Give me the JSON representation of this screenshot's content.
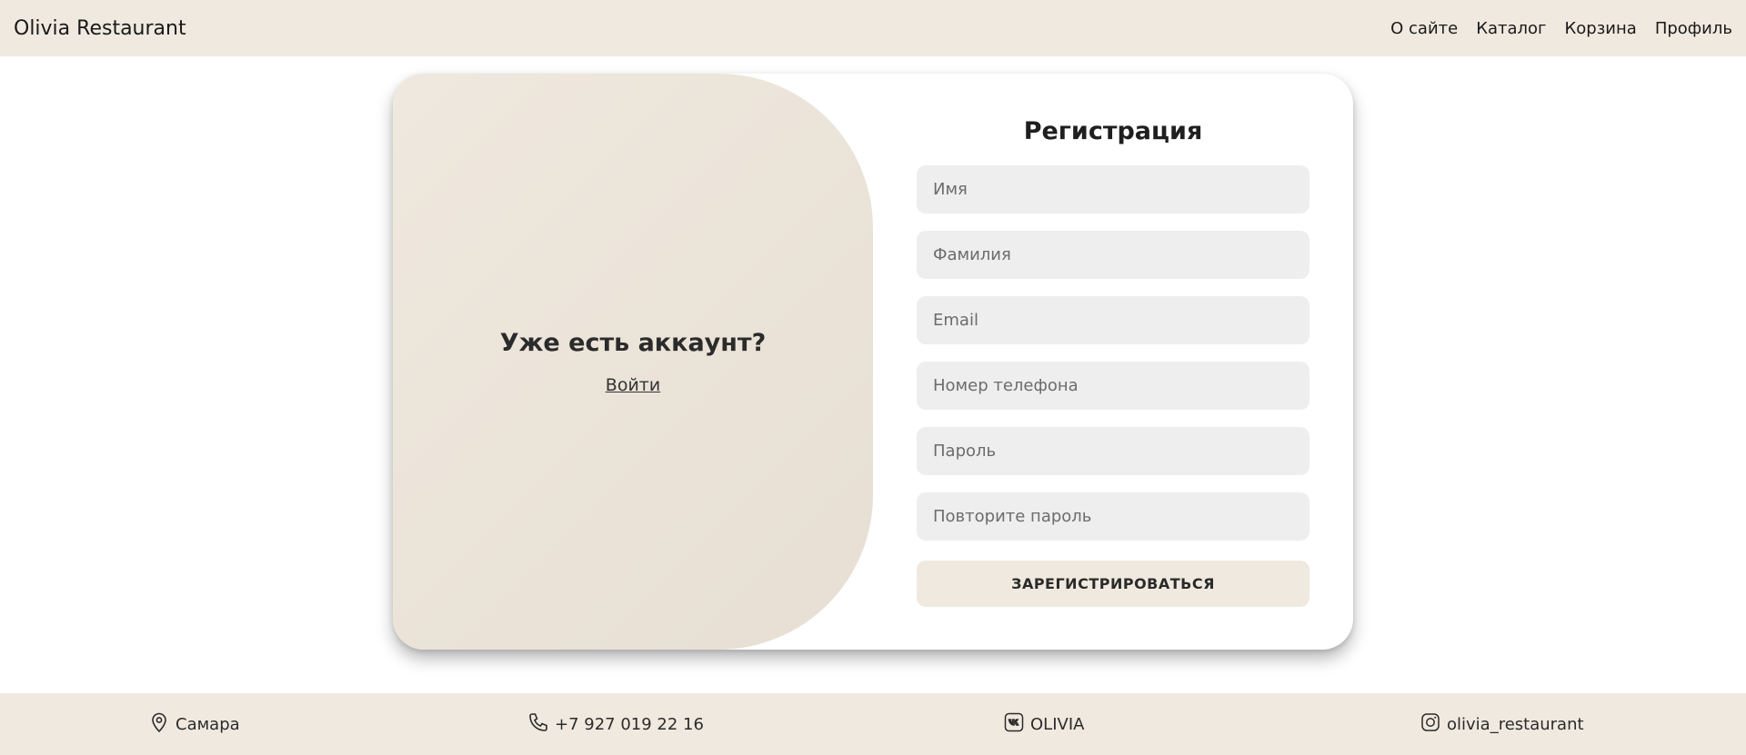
{
  "navbar": {
    "brand": "Olivia Restaurant",
    "links": [
      "О сайте",
      "Каталог",
      "Корзина",
      "Профиль"
    ]
  },
  "left_panel": {
    "title": "Уже есть аккаунт?",
    "login_link": "Войти"
  },
  "form": {
    "title": "Регистрация",
    "fields": [
      {
        "placeholder": "Имя",
        "value": ""
      },
      {
        "placeholder": "Фамилия",
        "value": ""
      },
      {
        "placeholder": "Email",
        "value": ""
      },
      {
        "placeholder": "Номер телефона",
        "value": ""
      },
      {
        "placeholder": "Пароль",
        "value": ""
      },
      {
        "placeholder": "Повторите пароль",
        "value": ""
      }
    ],
    "submit_label": "ЗАРЕГИСТРИРОВАТЬСЯ"
  },
  "footer": {
    "city": {
      "icon": "location-pin-icon",
      "text": "Самара"
    },
    "phone": {
      "icon": "phone-icon",
      "text": "+7 927 019 22 16"
    },
    "vk": {
      "icon": "vk-icon",
      "text": "OLIVIA"
    },
    "instagram": {
      "icon": "instagram-icon",
      "text": "olivia_restaurant"
    }
  },
  "colors": {
    "navbar_bg": "#f0e9df",
    "panel_bg": "#ebe4da",
    "field_bg": "#eeeeee",
    "button_bg": "#f0e9df"
  }
}
